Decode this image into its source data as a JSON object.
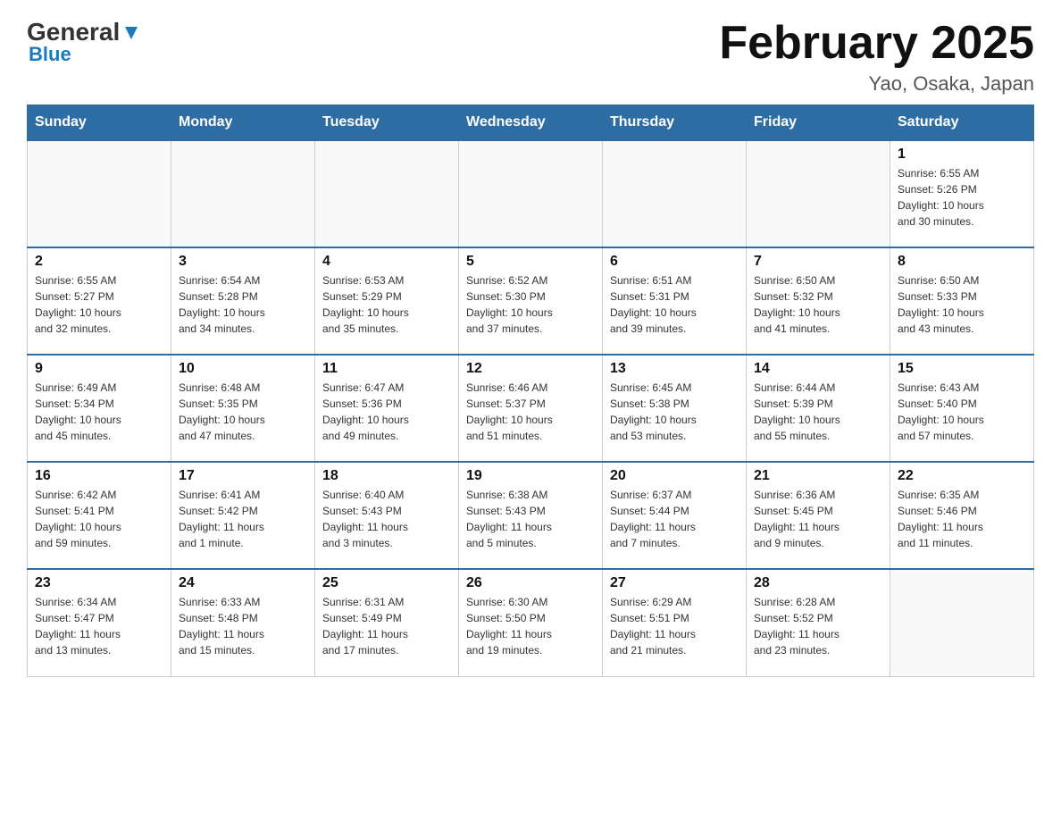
{
  "header": {
    "logo_general": "General",
    "logo_blue": "Blue",
    "month_title": "February 2025",
    "location": "Yao, Osaka, Japan"
  },
  "days_of_week": [
    "Sunday",
    "Monday",
    "Tuesday",
    "Wednesday",
    "Thursday",
    "Friday",
    "Saturday"
  ],
  "weeks": [
    [
      {
        "day": "",
        "info": ""
      },
      {
        "day": "",
        "info": ""
      },
      {
        "day": "",
        "info": ""
      },
      {
        "day": "",
        "info": ""
      },
      {
        "day": "",
        "info": ""
      },
      {
        "day": "",
        "info": ""
      },
      {
        "day": "1",
        "info": "Sunrise: 6:55 AM\nSunset: 5:26 PM\nDaylight: 10 hours\nand 30 minutes."
      }
    ],
    [
      {
        "day": "2",
        "info": "Sunrise: 6:55 AM\nSunset: 5:27 PM\nDaylight: 10 hours\nand 32 minutes."
      },
      {
        "day": "3",
        "info": "Sunrise: 6:54 AM\nSunset: 5:28 PM\nDaylight: 10 hours\nand 34 minutes."
      },
      {
        "day": "4",
        "info": "Sunrise: 6:53 AM\nSunset: 5:29 PM\nDaylight: 10 hours\nand 35 minutes."
      },
      {
        "day": "5",
        "info": "Sunrise: 6:52 AM\nSunset: 5:30 PM\nDaylight: 10 hours\nand 37 minutes."
      },
      {
        "day": "6",
        "info": "Sunrise: 6:51 AM\nSunset: 5:31 PM\nDaylight: 10 hours\nand 39 minutes."
      },
      {
        "day": "7",
        "info": "Sunrise: 6:50 AM\nSunset: 5:32 PM\nDaylight: 10 hours\nand 41 minutes."
      },
      {
        "day": "8",
        "info": "Sunrise: 6:50 AM\nSunset: 5:33 PM\nDaylight: 10 hours\nand 43 minutes."
      }
    ],
    [
      {
        "day": "9",
        "info": "Sunrise: 6:49 AM\nSunset: 5:34 PM\nDaylight: 10 hours\nand 45 minutes."
      },
      {
        "day": "10",
        "info": "Sunrise: 6:48 AM\nSunset: 5:35 PM\nDaylight: 10 hours\nand 47 minutes."
      },
      {
        "day": "11",
        "info": "Sunrise: 6:47 AM\nSunset: 5:36 PM\nDaylight: 10 hours\nand 49 minutes."
      },
      {
        "day": "12",
        "info": "Sunrise: 6:46 AM\nSunset: 5:37 PM\nDaylight: 10 hours\nand 51 minutes."
      },
      {
        "day": "13",
        "info": "Sunrise: 6:45 AM\nSunset: 5:38 PM\nDaylight: 10 hours\nand 53 minutes."
      },
      {
        "day": "14",
        "info": "Sunrise: 6:44 AM\nSunset: 5:39 PM\nDaylight: 10 hours\nand 55 minutes."
      },
      {
        "day": "15",
        "info": "Sunrise: 6:43 AM\nSunset: 5:40 PM\nDaylight: 10 hours\nand 57 minutes."
      }
    ],
    [
      {
        "day": "16",
        "info": "Sunrise: 6:42 AM\nSunset: 5:41 PM\nDaylight: 10 hours\nand 59 minutes."
      },
      {
        "day": "17",
        "info": "Sunrise: 6:41 AM\nSunset: 5:42 PM\nDaylight: 11 hours\nand 1 minute."
      },
      {
        "day": "18",
        "info": "Sunrise: 6:40 AM\nSunset: 5:43 PM\nDaylight: 11 hours\nand 3 minutes."
      },
      {
        "day": "19",
        "info": "Sunrise: 6:38 AM\nSunset: 5:43 PM\nDaylight: 11 hours\nand 5 minutes."
      },
      {
        "day": "20",
        "info": "Sunrise: 6:37 AM\nSunset: 5:44 PM\nDaylight: 11 hours\nand 7 minutes."
      },
      {
        "day": "21",
        "info": "Sunrise: 6:36 AM\nSunset: 5:45 PM\nDaylight: 11 hours\nand 9 minutes."
      },
      {
        "day": "22",
        "info": "Sunrise: 6:35 AM\nSunset: 5:46 PM\nDaylight: 11 hours\nand 11 minutes."
      }
    ],
    [
      {
        "day": "23",
        "info": "Sunrise: 6:34 AM\nSunset: 5:47 PM\nDaylight: 11 hours\nand 13 minutes."
      },
      {
        "day": "24",
        "info": "Sunrise: 6:33 AM\nSunset: 5:48 PM\nDaylight: 11 hours\nand 15 minutes."
      },
      {
        "day": "25",
        "info": "Sunrise: 6:31 AM\nSunset: 5:49 PM\nDaylight: 11 hours\nand 17 minutes."
      },
      {
        "day": "26",
        "info": "Sunrise: 6:30 AM\nSunset: 5:50 PM\nDaylight: 11 hours\nand 19 minutes."
      },
      {
        "day": "27",
        "info": "Sunrise: 6:29 AM\nSunset: 5:51 PM\nDaylight: 11 hours\nand 21 minutes."
      },
      {
        "day": "28",
        "info": "Sunrise: 6:28 AM\nSunset: 5:52 PM\nDaylight: 11 hours\nand 23 minutes."
      },
      {
        "day": "",
        "info": ""
      }
    ]
  ]
}
